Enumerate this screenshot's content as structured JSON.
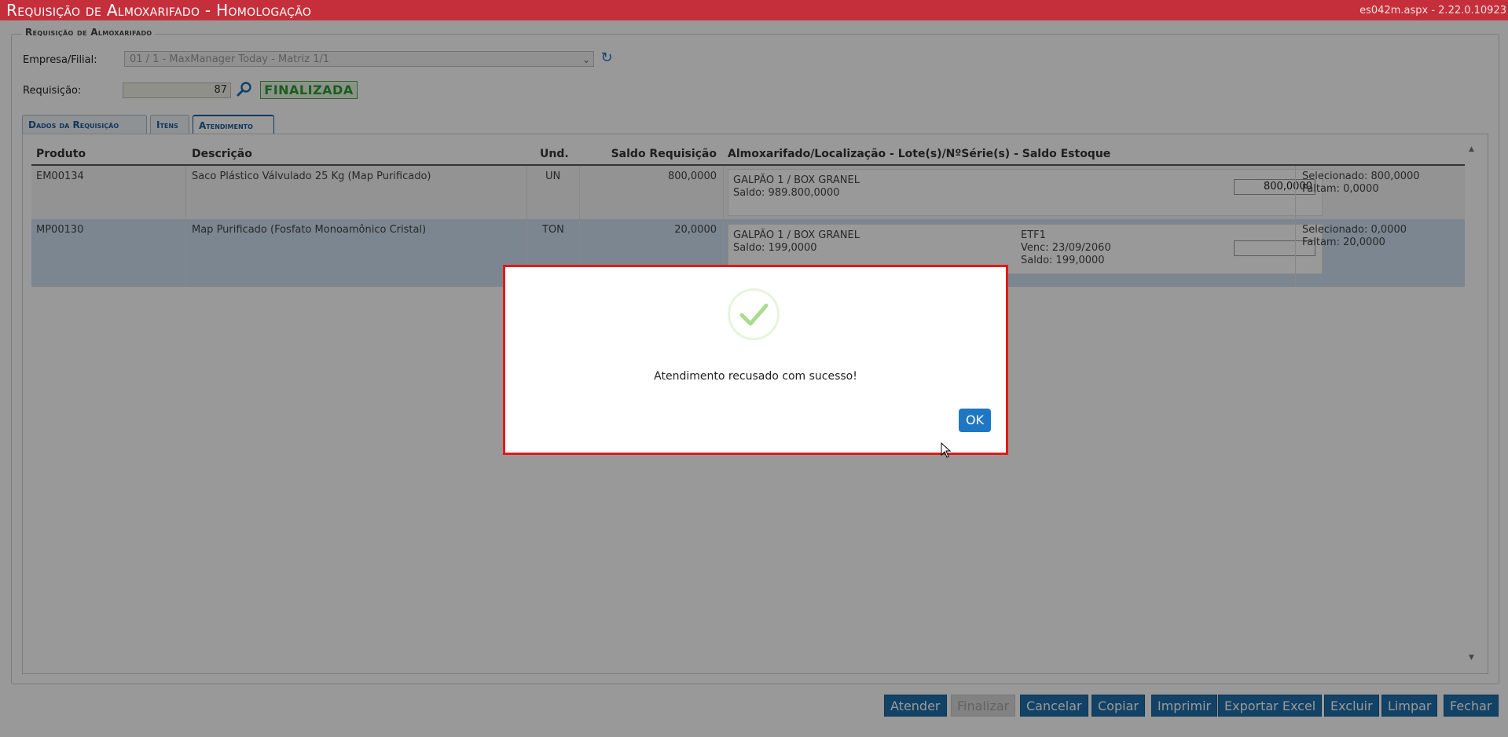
{
  "header": {
    "title": "Requisição de Almoxarifado  - Homologação",
    "version": "es042m.aspx - 2.22.0.10923"
  },
  "form": {
    "legend": "Requisição de Almoxarifado",
    "empresa_label": "Empresa/Filial:",
    "empresa_value": "01 / 1 - MaxManager Today - Matriz 1/1",
    "requisicao_label": "Requisição:",
    "requisicao_value": "87",
    "status": "FINALIZADA"
  },
  "tabs": [
    {
      "label": "Dados da Requisição"
    },
    {
      "label": "Itens"
    },
    {
      "label": "Atendimento"
    }
  ],
  "grid": {
    "columns": [
      "Produto",
      "Descrição",
      "Und.",
      "Saldo Requisição",
      "Almoxarifado/Localização - Lote(s)/NºSérie(s) - Saldo Estoque"
    ],
    "rows": [
      {
        "produto": "EM00134",
        "descricao": "Saco Plástico Válvulado 25 Kg (Map Purificado)",
        "und": "UN",
        "saldo": "800,0000",
        "local": "GALPÃO 1 / BOX GRANEL",
        "local_saldo": "Saldo: 989.800,0000",
        "qty": "800,0000",
        "selecionado": "Selecionado: 800,0000",
        "faltam": "Faltam: 0,0000"
      },
      {
        "produto": "MP00130",
        "descricao": "Map Purificado (Fosfato Monoamônico Cristal)",
        "und": "TON",
        "saldo": "20,0000",
        "local": "GALPÃO 1 / BOX GRANEL",
        "local_saldo": "Saldo: 199,0000",
        "lote": "ETF1",
        "lote_venc": "Venc: 23/09/2060",
        "lote_saldo": "Saldo: 199,0000",
        "qty": "",
        "selecionado": "Selecionado: 0,0000",
        "faltam": "Faltam: 20,0000"
      }
    ]
  },
  "modal": {
    "message": "Atendimento recusado com sucesso!",
    "ok_label": "OK",
    "check_color": "#a8dc8c",
    "border_color": "#e11a1a"
  },
  "buttons": {
    "atender": "Atender",
    "finalizar": "Finalizar",
    "cancelar": "Cancelar",
    "copiar": "Copiar",
    "imprimir": "Imprimir",
    "exportar": "Exportar Excel",
    "excluir": "Excluir",
    "limpar": "Limpar",
    "fechar": "Fechar"
  }
}
